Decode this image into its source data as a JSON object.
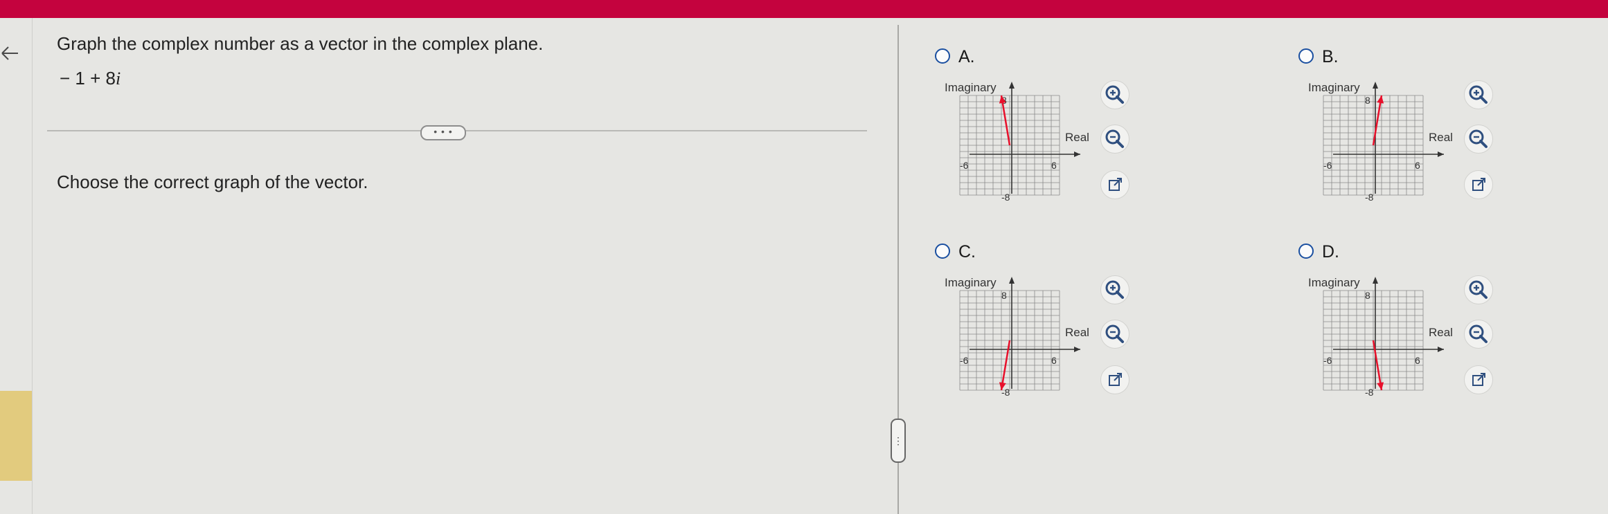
{
  "header": {
    "bar_color": "#c4033e"
  },
  "question": {
    "instruction": "Graph the complex number as a vector in the complex plane.",
    "expression_prefix": "− 1 + 8",
    "expression_unit": "i"
  },
  "more_button": {
    "label": "• • •"
  },
  "prompt": "Choose the correct graph of the vector.",
  "choices": [
    {
      "letter": "A.",
      "y_axis": "Imaginary",
      "x_axis": "Real",
      "y_max": "8",
      "y_min": "-8",
      "x_min": "-6",
      "x_max": "6",
      "vector": [
        -1,
        8
      ]
    },
    {
      "letter": "B.",
      "y_axis": "Imaginary",
      "x_axis": "Real",
      "y_max": "8",
      "y_min": "-8",
      "x_min": "-6",
      "x_max": "6",
      "vector": [
        1,
        8
      ]
    },
    {
      "letter": "C.",
      "y_axis": "Imaginary",
      "x_axis": "Real",
      "y_max": "8",
      "y_min": "-8",
      "x_min": "-6",
      "x_max": "6",
      "vector": [
        -1,
        -8
      ]
    },
    {
      "letter": "D.",
      "y_axis": "Imaginary",
      "x_axis": "Real",
      "y_max": "8",
      "y_min": "-8",
      "x_min": "-6",
      "x_max": "6",
      "vector": [
        1,
        -8
      ]
    }
  ],
  "icons": {
    "zoom_in": "zoom-in-icon",
    "zoom_out": "zoom-out-icon",
    "open_window": "external-link-icon",
    "back": "back-arrow-icon",
    "more": "more-dots-icon"
  },
  "colors": {
    "vector": "#e8102b",
    "radio": "#1a4fa0",
    "grid": "#8a8a8a"
  }
}
